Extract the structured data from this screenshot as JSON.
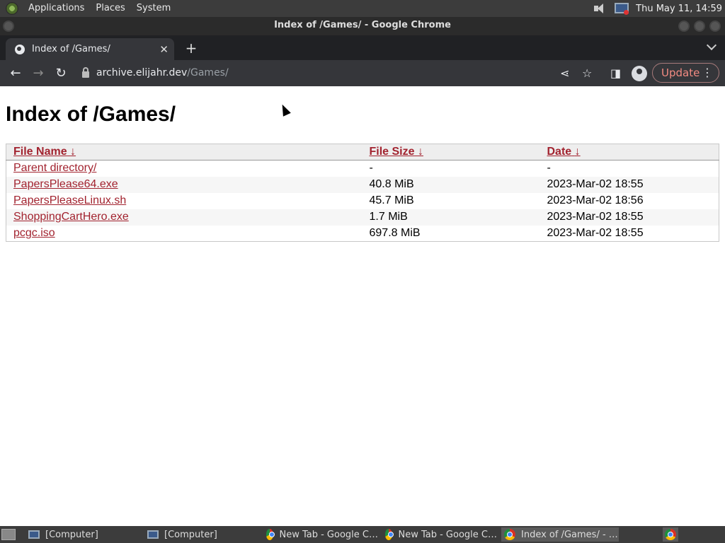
{
  "system_panel": {
    "menus": [
      "Applications",
      "Places",
      "System"
    ],
    "clock": "Thu May 11, 14:59"
  },
  "window": {
    "title": "Index of /Games/ - Google Chrome"
  },
  "tab": {
    "title": "Index of /Games/",
    "close": "✕"
  },
  "toolbar": {
    "url_host": "archive.elijahr.dev",
    "url_path": "/Games/",
    "update_label": "Update"
  },
  "page": {
    "heading": "Index of /Games/",
    "columns": [
      "File Name",
      "File Size",
      "Date"
    ],
    "sort_arrow": "↓",
    "rows": [
      {
        "name": "Parent directory/",
        "size": "-",
        "date": "-"
      },
      {
        "name": "PapersPlease64.exe",
        "size": "40.8 MiB",
        "date": "2023-Mar-02 18:55"
      },
      {
        "name": "PapersPleaseLinux.sh",
        "size": "45.7 MiB",
        "date": "2023-Mar-02 18:56"
      },
      {
        "name": "ShoppingCartHero.exe",
        "size": "1.7 MiB",
        "date": "2023-Mar-02 18:55"
      },
      {
        "name": "pcgc.iso",
        "size": "697.8 MiB",
        "date": "2023-Mar-02 18:55"
      }
    ]
  },
  "taskbar": {
    "items": [
      {
        "label": "[Computer]",
        "icon": "computer-icon"
      },
      {
        "label": "[Computer]",
        "icon": "computer-icon"
      },
      {
        "label": "New Tab - Google C…",
        "icon": "chrome-icon"
      },
      {
        "label": "New Tab - Google C…",
        "icon": "chrome-icon"
      },
      {
        "label": "Index of /Games/ - …",
        "icon": "chrome-icon"
      }
    ]
  }
}
